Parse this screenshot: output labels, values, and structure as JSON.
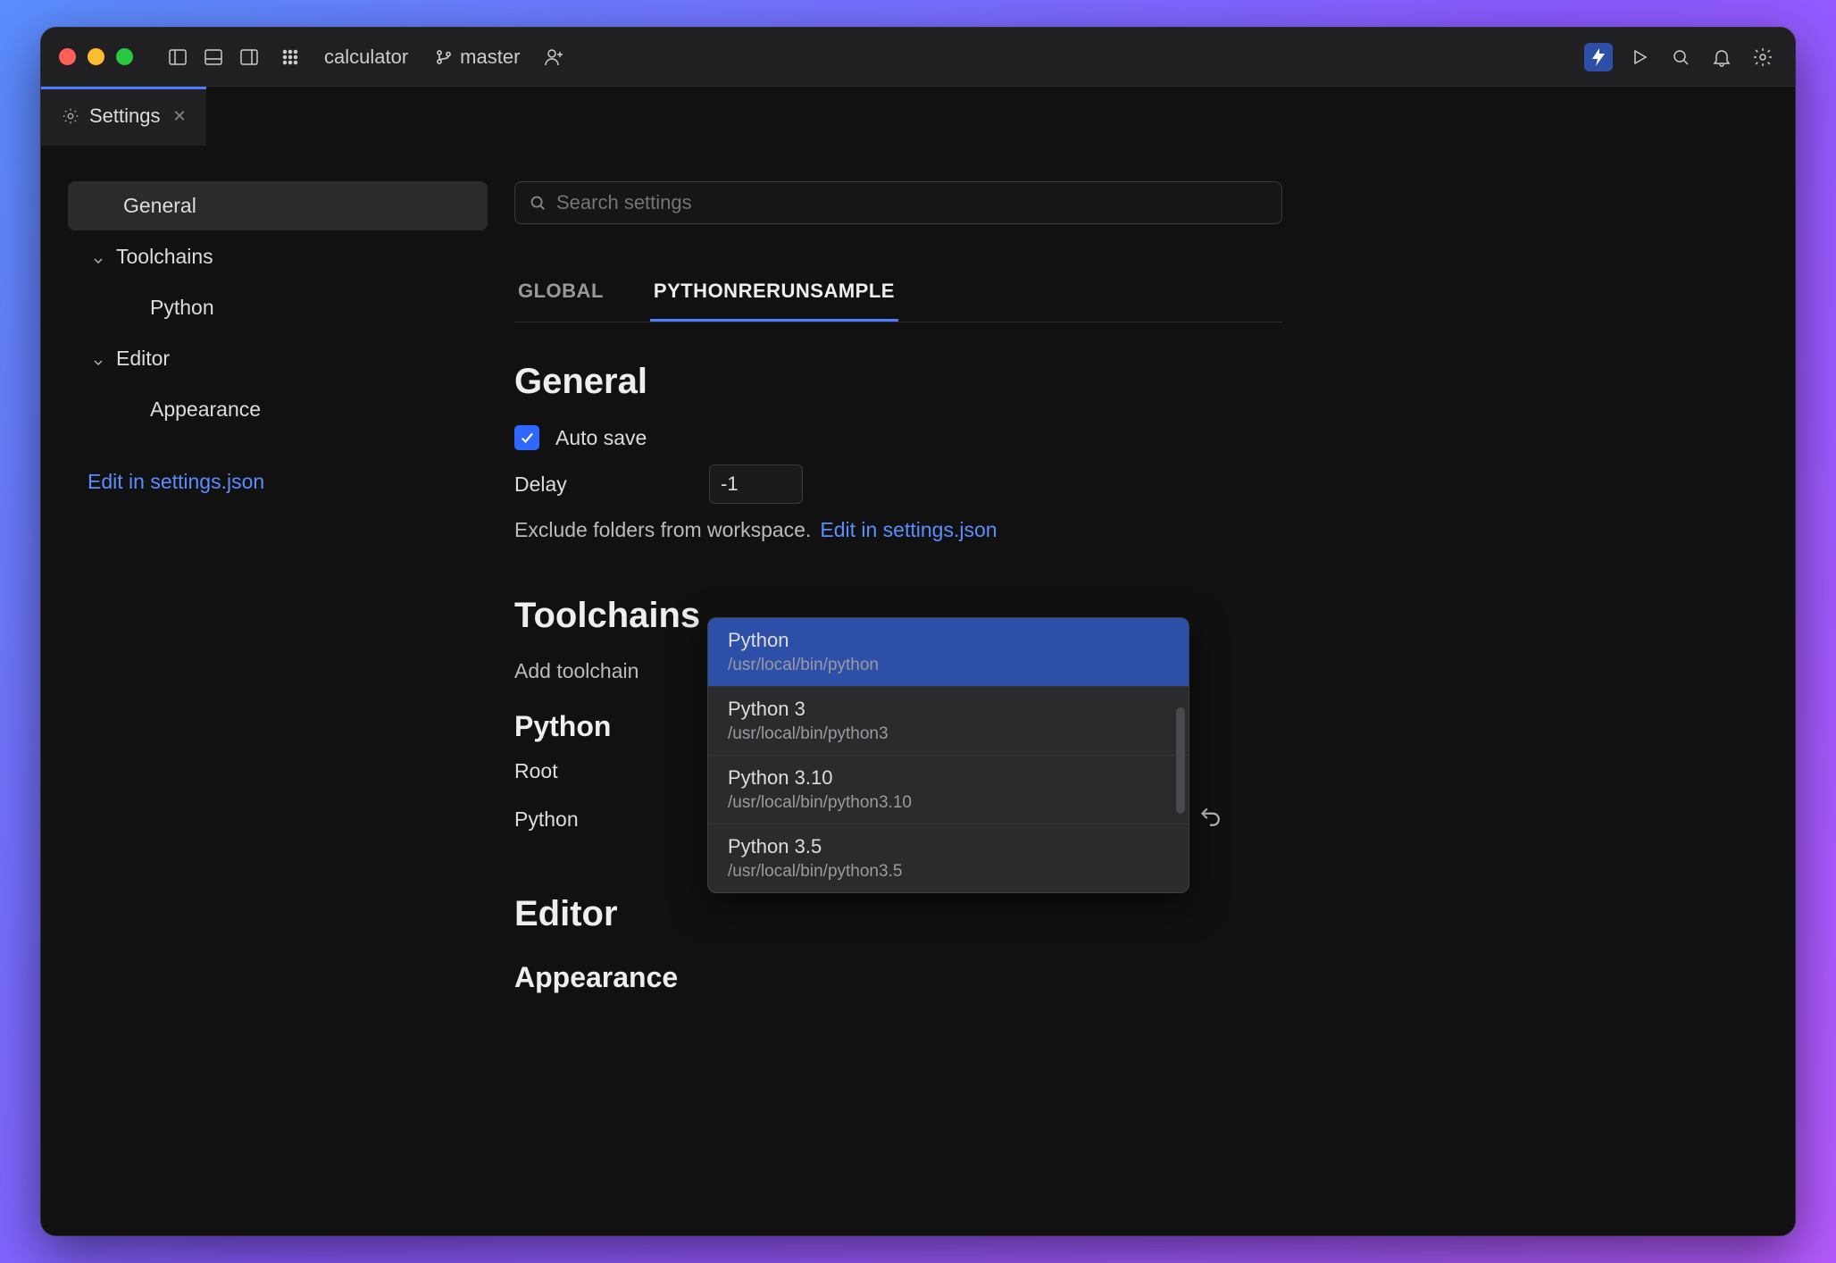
{
  "titlebar": {
    "project": "calculator",
    "branch": "master"
  },
  "tab": {
    "label": "Settings"
  },
  "sidebar": {
    "items": [
      {
        "label": "General",
        "selected": true
      },
      {
        "label": "Toolchains",
        "expandable": true
      },
      {
        "label": "Python",
        "indent": true
      },
      {
        "label": "Editor",
        "expandable": true
      },
      {
        "label": "Appearance",
        "indent": true
      }
    ],
    "link": "Edit in settings.json"
  },
  "search": {
    "placeholder": "Search settings"
  },
  "scope": {
    "tabs": [
      "GLOBAL",
      "PYTHONRERUNSAMPLE"
    ],
    "active": 1
  },
  "sections": {
    "general": {
      "title": "General",
      "autosave_label": "Auto save",
      "autosave_checked": true,
      "delay_label": "Delay",
      "delay_value": "-1",
      "exclude_text": "Exclude folders from workspace.",
      "exclude_link": "Edit in settings.json"
    },
    "toolchains": {
      "title": "Toolchains",
      "add_label": "Add toolchain"
    },
    "python": {
      "title": "Python",
      "root_label": "Root",
      "python_label": "Python",
      "select_value": "Python 3"
    },
    "editor": {
      "title": "Editor"
    },
    "appearance": {
      "title": "Appearance"
    }
  },
  "dropdown": {
    "items": [
      {
        "name": "Python",
        "path": "/usr/local/bin/python",
        "selected": true
      },
      {
        "name": "Python 3",
        "path": "/usr/local/bin/python3"
      },
      {
        "name": "Python 3.10",
        "path": "/usr/local/bin/python3.10"
      },
      {
        "name": "Python 3.5",
        "path": "/usr/local/bin/python3.5"
      }
    ]
  }
}
